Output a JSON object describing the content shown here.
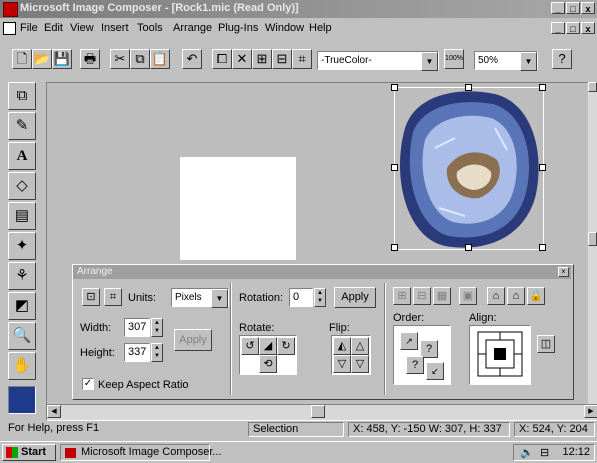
{
  "window": {
    "title": "Microsoft Image Composer - [Rock1.mic (Read Only)]",
    "controls": [
      "_",
      "□",
      "x"
    ]
  },
  "menu": [
    "File",
    "Edit",
    "View",
    "Insert",
    "Tools",
    "Arrange",
    "Plug-Ins",
    "Window",
    "Help"
  ],
  "toolbar": {
    "color_format": "-TrueColor-",
    "color_format_btn": "100%",
    "zoom": "50%"
  },
  "arrange_panel": {
    "title": "Arrange",
    "units_label": "Units:",
    "units_value": "Pixels",
    "rotation_label": "Rotation:",
    "rotation_value": "0",
    "rotation_apply": "Apply",
    "width_label": "Width:",
    "width_value": "307",
    "height_label": "Height:",
    "height_value": "337",
    "size_apply": "Apply",
    "rotate_label": "Rotate:",
    "flip_label": "Flip:",
    "order_label": "Order:",
    "align_label": "Align:",
    "keep_aspect": "Keep Aspect Ratio",
    "keep_aspect_checked": true
  },
  "status": {
    "help": "For Help, press F1",
    "mode": "Selection",
    "selection_info": "X: 458, Y: -150  W: 307, H: 337",
    "cursor_info": "X: 524, Y: 204"
  },
  "taskbar": {
    "start": "Start",
    "task": "Microsoft Image Composer...",
    "clock": "12:12"
  },
  "colors": {
    "title_inactive": "#808080",
    "face": "#c0c0c0",
    "swatch": "#1f3a8a"
  }
}
